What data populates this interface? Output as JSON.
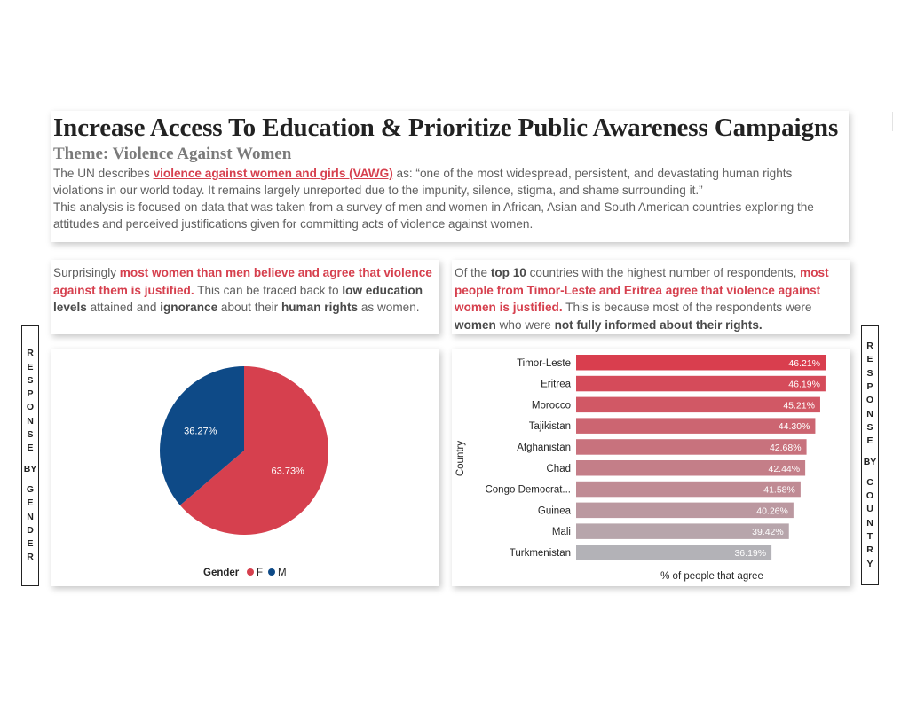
{
  "header": {
    "title": "Increase Access To Education & Prioritize Public Awareness Campaigns",
    "subtitle": "Theme: Violence Against Women",
    "intro_prefix": "The UN describes ",
    "intro_link": "violence against women and girls (VAWG)",
    "intro_suffix": " as: “one of the most widespread, persistent, and devastating human rights violations in our world today. It remains largely unreported due to the impunity, silence, stigma, and shame surrounding it.”",
    "intro_second": "This analysis is focused on data that was taken from a survey of men and women in African, Asian and South American countries exploring the attitudes and perceived justifications given for committing acts of violence against women."
  },
  "left_insight": {
    "t1": "Surprisingly ",
    "h1": "most women than men believe and agree that violence against them is justified.",
    "t2": " This can be traced back to ",
    "b1": "low education levels",
    "t3": " attained and ",
    "b2": "ignorance",
    "t4": " about their ",
    "b3": "human rights",
    "t5": " as women."
  },
  "right_insight": {
    "t1": "Of the ",
    "b1": "top 10",
    "t2": " countries with the highest number of respondents, ",
    "h1": "most people from Timor-Leste and Eritrea agree that violence against women is justified.",
    "t3": " This is because most of the respondents were ",
    "b2": "women",
    "t4": " who were ",
    "b3": "not fully informed about their rights."
  },
  "side_labels": {
    "left": [
      "R",
      "E",
      "S",
      "P",
      "O",
      "N",
      "S",
      "E",
      "",
      "BY",
      "",
      "G",
      "E",
      "N",
      "D",
      "E",
      "R"
    ],
    "right": [
      "R",
      "E",
      "S",
      "P",
      "O",
      "N",
      "S",
      "E",
      "",
      "BY",
      "",
      "C",
      "O",
      "U",
      "N",
      "T",
      "R",
      "Y"
    ]
  },
  "colors": {
    "female": "#d6404e",
    "male": "#0e4a87",
    "bar_top": "#d93e4e",
    "bar_bottom": "#b3b2b7"
  },
  "chart_data": [
    {
      "type": "pie",
      "legend_title": "Gender",
      "slices": [
        {
          "name": "F",
          "value": 63.73,
          "label": "63.73%"
        },
        {
          "name": "M",
          "value": 36.27,
          "label": "36.27%"
        }
      ],
      "legend_placement": "bottom"
    },
    {
      "type": "bar",
      "orientation": "horizontal",
      "ylabel": "Country",
      "xlabel": "% of people that agree",
      "categories": [
        "Timor-Leste",
        "Eritrea",
        "Morocco",
        "Tajikistan",
        "Afghanistan",
        "Chad",
        "Congo Democrat...",
        "Guinea",
        "Mali",
        "Turkmenistan"
      ],
      "values": [
        46.21,
        46.19,
        45.21,
        44.3,
        42.68,
        42.44,
        41.58,
        40.26,
        39.42,
        36.19
      ],
      "labels": [
        "46.21%",
        "46.19%",
        "45.21%",
        "44.30%",
        "42.68%",
        "42.44%",
        "41.58%",
        "40.26%",
        "39.42%",
        "36.19%"
      ],
      "grid": false
    }
  ]
}
